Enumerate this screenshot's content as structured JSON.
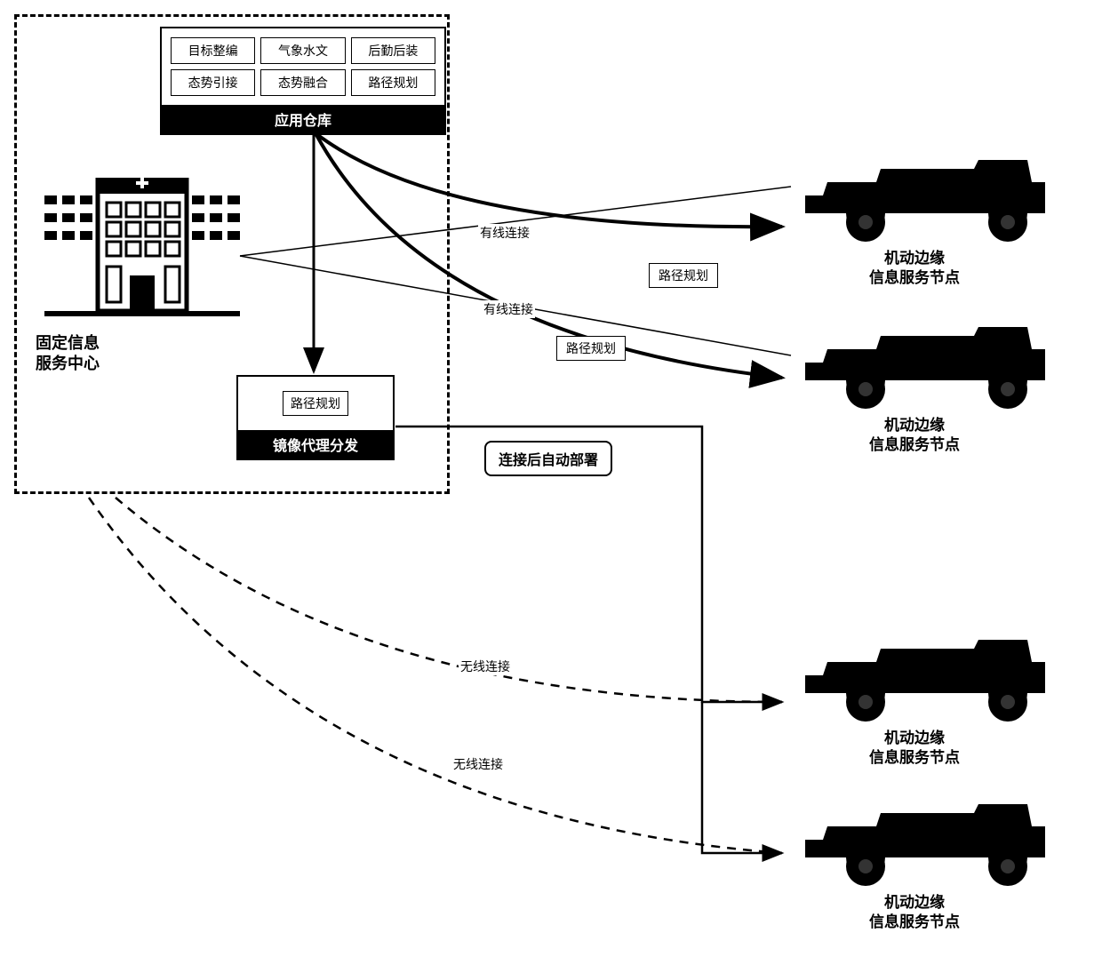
{
  "appWarehouse": {
    "title": "应用仓库",
    "items": [
      "目标整编",
      "气象水文",
      "后勤后装",
      "态势引接",
      "态势融合",
      "路径规划"
    ]
  },
  "mirrorProxy": {
    "title": "镜像代理分发",
    "item": "路径规划"
  },
  "fixedCenter": {
    "label": "固定信息\n服务中心"
  },
  "deployLabel": "连接后自动部署",
  "connections": {
    "wired": "有线连接",
    "wireless": "无线连接"
  },
  "pathPlanBox": "路径规划",
  "edgeNode": {
    "label": "机动边缘\n信息服务节点"
  }
}
